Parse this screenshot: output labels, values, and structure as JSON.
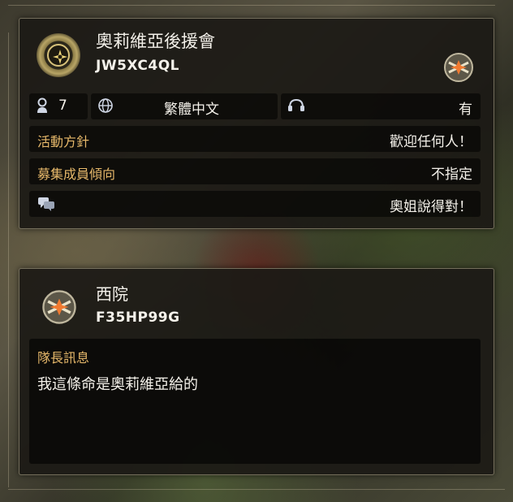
{
  "clan": {
    "name": "奧莉維亞後援會",
    "code": "JW5XC4QL",
    "member_count": "7",
    "language": "繁體中文",
    "voice_chat": "有",
    "policy_label": "活動方針",
    "policy_value": "歡迎任何人！",
    "recruit_label": "募集成員傾向",
    "recruit_value": "不指定",
    "motto": "奧姐說得對！"
  },
  "member": {
    "name": "西院",
    "code": "F35HP99G",
    "message_label": "隊長訊息",
    "message": "我這條命是奧莉維亞給的"
  },
  "colors": {
    "accent_label": "#e6b86a",
    "text": "#f4f1ea",
    "panel_bg": "#1c1a16"
  },
  "icons": {
    "clan_emblem": "gold-star-emblem-icon",
    "rank_emblem": "crossed-arrows-emblem-icon",
    "members": "member-bust-icon",
    "language": "globe-icon",
    "voice": "headset-icon",
    "motto": "chat-bubbles-icon"
  }
}
